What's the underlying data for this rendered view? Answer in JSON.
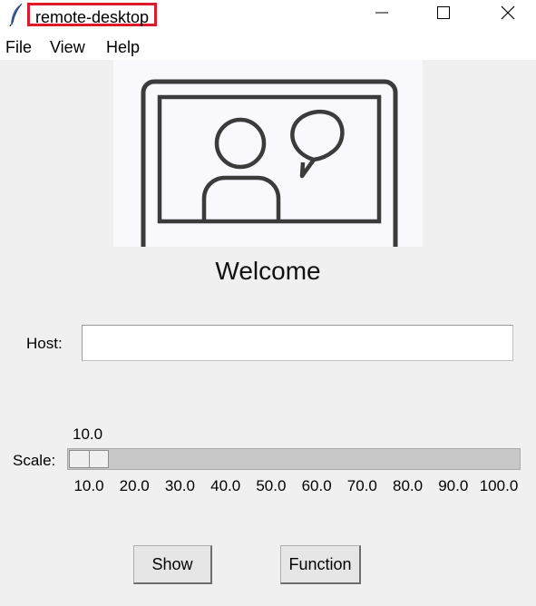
{
  "window": {
    "title": "remote-desktop",
    "icons": {
      "app": "feather-icon",
      "minimize": "minimize-icon",
      "maximize": "maximize-icon",
      "close": "close-icon"
    }
  },
  "menu": {
    "items": [
      {
        "label": "File"
      },
      {
        "label": "View"
      },
      {
        "label": "Help"
      }
    ]
  },
  "image": {
    "icon": "video-chat-person-speech-bubble-icon"
  },
  "main": {
    "welcome": "Welcome"
  },
  "host": {
    "label": "Host:",
    "value": "",
    "placeholder": ""
  },
  "scale": {
    "label": "Scale:",
    "value_text": "10.0",
    "value": 10.0,
    "min": 10.0,
    "max": 100.0,
    "ticks": [
      "10.0",
      "20.0",
      "30.0",
      "40.0",
      "50.0",
      "60.0",
      "70.0",
      "80.0",
      "90.0",
      "100.0"
    ]
  },
  "buttons": {
    "show": "Show",
    "function": "Function"
  }
}
